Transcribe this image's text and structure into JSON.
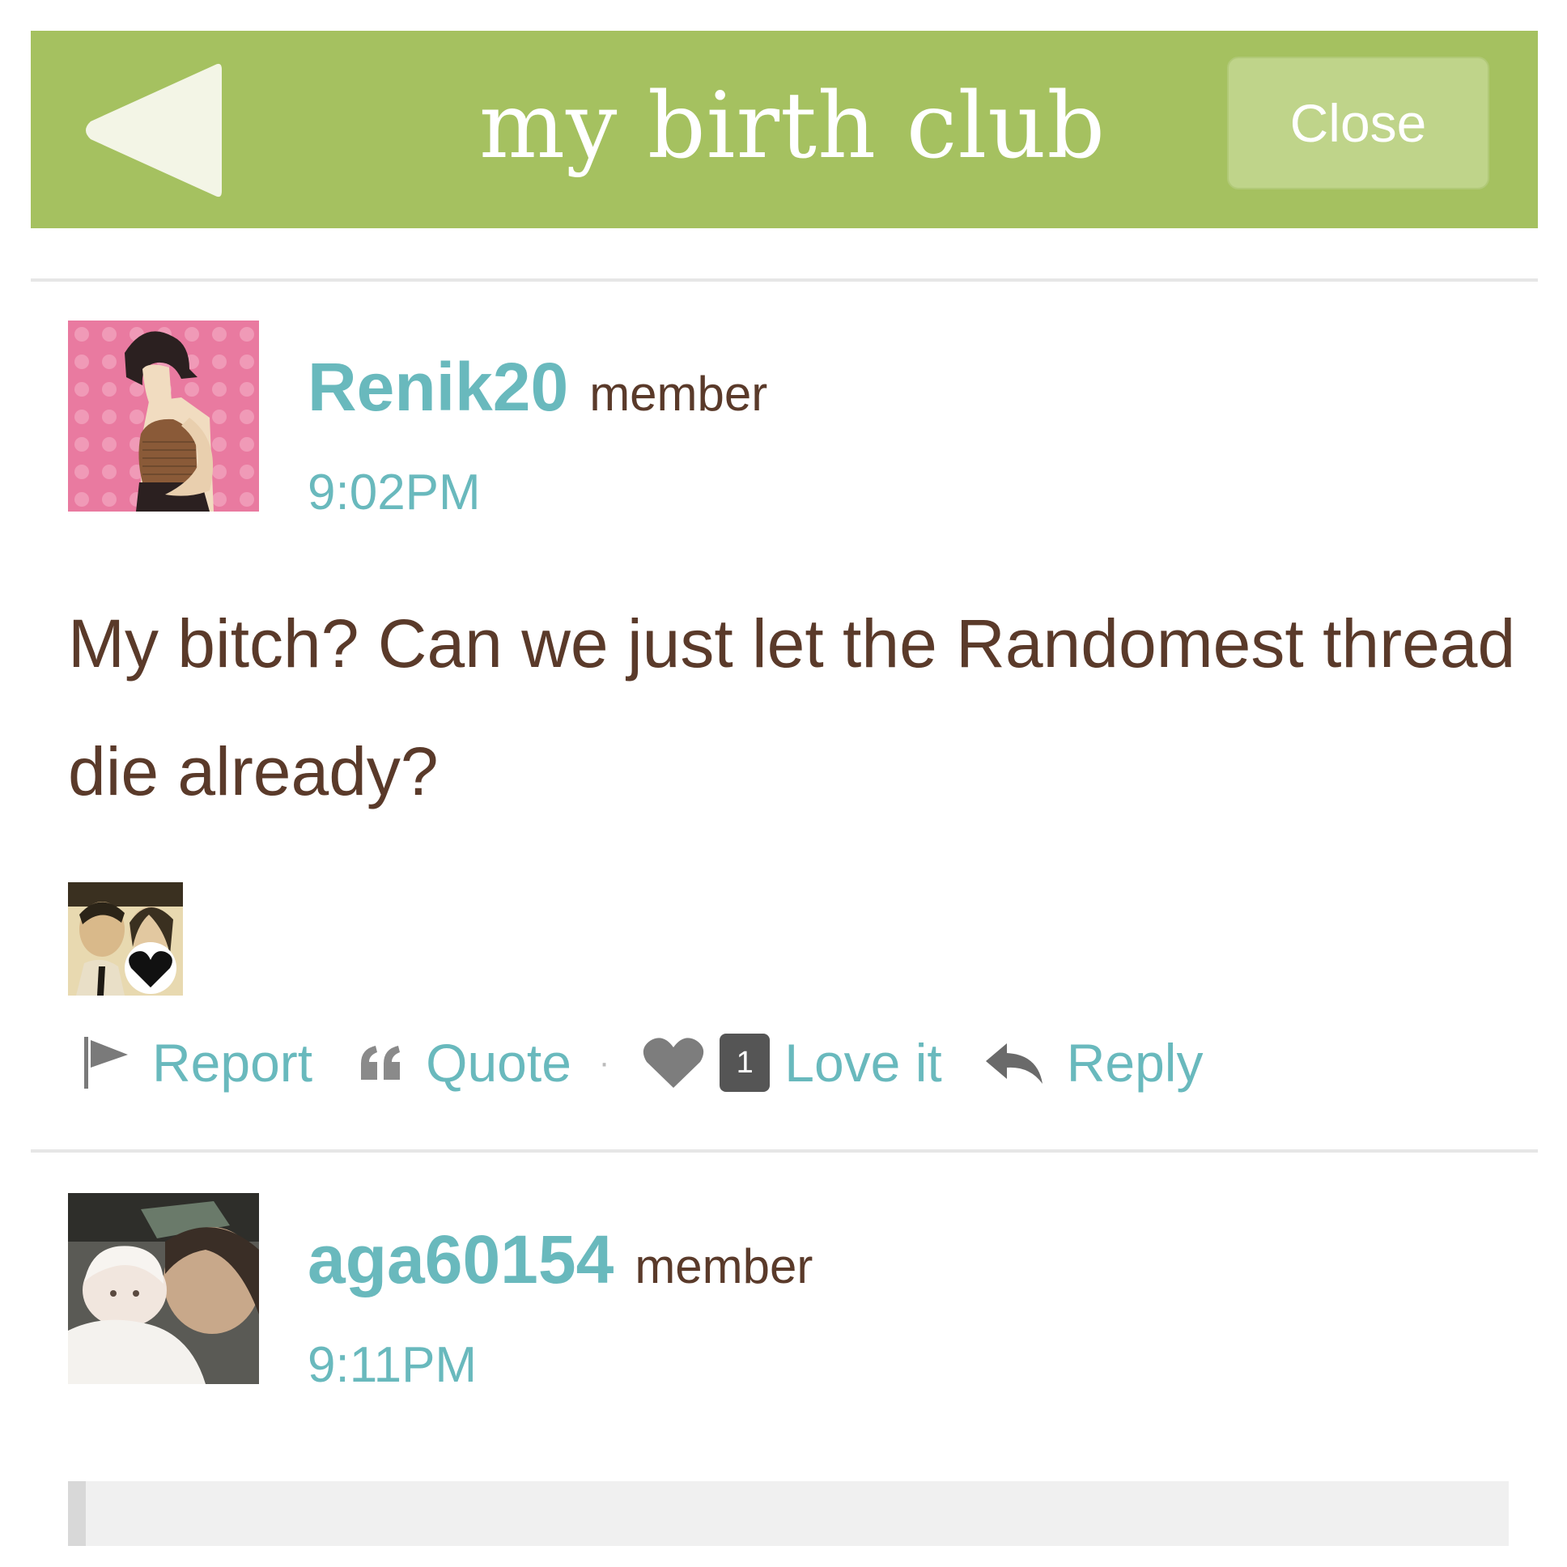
{
  "header": {
    "title": "my birth club",
    "close_label": "Close",
    "color": "#a5c160"
  },
  "posts": [
    {
      "username": "Renik20",
      "role": "member",
      "time": "9:02PM",
      "body": "My bitch? Can we just let the Randomest thread die already?",
      "avatar_icon": "pregnant-woman-avatar"
    },
    {
      "username": "aga60154",
      "role": "member",
      "time": "9:11PM",
      "avatar_icon": "baby-photo-avatar"
    }
  ],
  "actions": {
    "report": "Report",
    "quote": "Quote",
    "love_count": "1",
    "love": "Love it",
    "reply": "Reply"
  },
  "colors": {
    "link": "#69b9bd",
    "text": "#5a3a2a"
  }
}
